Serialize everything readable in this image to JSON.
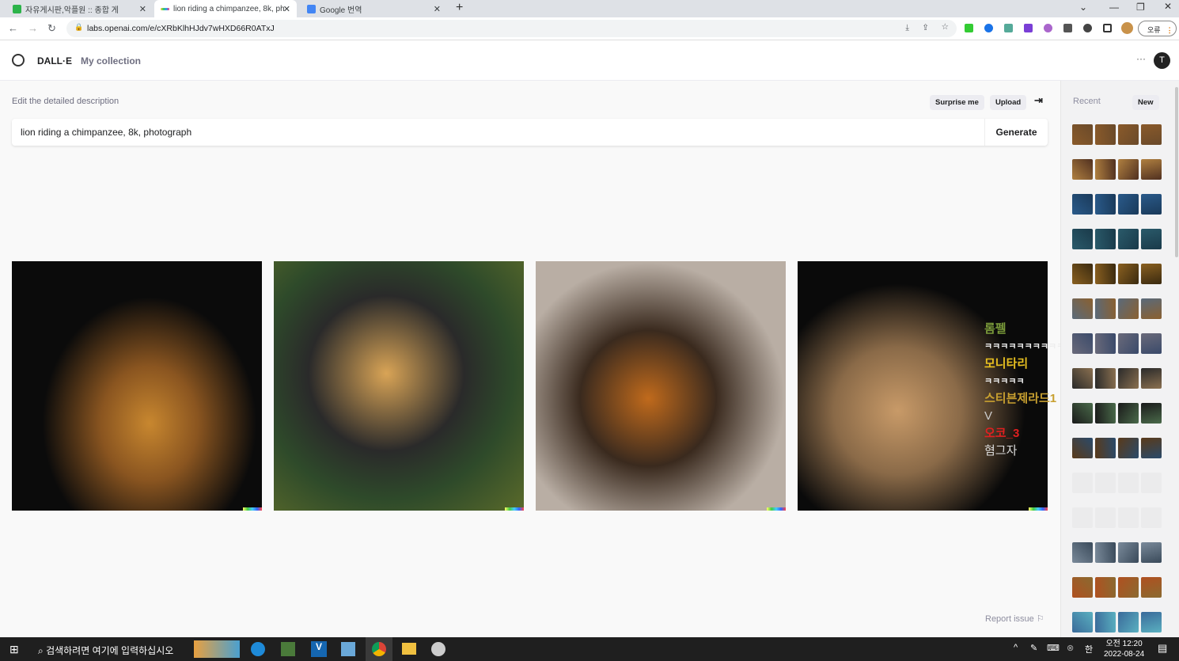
{
  "browser": {
    "tabs": [
      {
        "label": "자유게시판,악플원 :: 종합 게"
      },
      {
        "label": "lion riding a chimpanzee, 8k, ph"
      },
      {
        "label": "Google 번역"
      }
    ],
    "new_tab": "+",
    "url": "labs.openai.com/e/cXRbKlhHJdv7wHXD66R0ATxJ",
    "profile_button": "오류"
  },
  "app": {
    "brand": "DALL·E",
    "nav_collection": "My collection",
    "avatar_initial": "T",
    "more": "···"
  },
  "editor": {
    "label": "Edit the detailed description",
    "surprise": "Surprise me",
    "upload": "Upload",
    "prompt": "lion riding a chimpanzee, 8k, photograph",
    "generate": "Generate"
  },
  "images": [
    {
      "name": "result-1",
      "colors": [
        "#0b0b0b",
        "#c8872f"
      ]
    },
    {
      "name": "result-2",
      "colors": [
        "#2e4a2a",
        "#c99a48"
      ]
    },
    {
      "name": "result-3",
      "colors": [
        "#b9aea4",
        "#6b3e16"
      ]
    },
    {
      "name": "result-4",
      "colors": [
        "#0a0a0a",
        "#b98a58"
      ]
    }
  ],
  "overlay_chat": [
    "롬펠",
    "ㅋㅋㅋㅋㅋㅋㅋㅋㅋㅋ",
    "모니타리",
    "ㅋㅋㅋㅋㅋ",
    "스티븐제라드1",
    "V",
    "오코_3",
    "혐그자"
  ],
  "sidebar": {
    "title": "Recent",
    "new": "New"
  },
  "report": "Report issue",
  "taskbar": {
    "search": "검색하려면 여기에 입력하십시오",
    "time": "오전 12:20",
    "date": "2022-08-24",
    "ime": "한"
  }
}
